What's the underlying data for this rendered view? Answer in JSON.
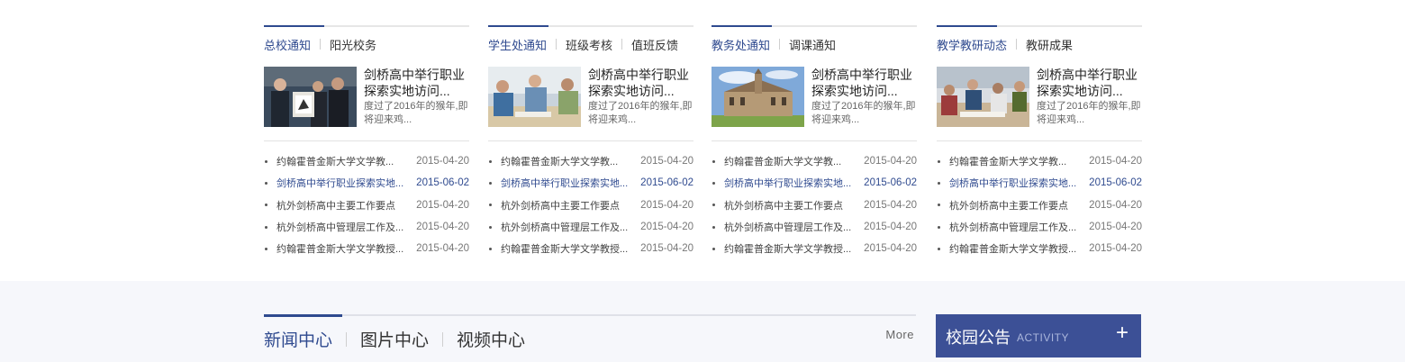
{
  "columns": [
    {
      "tabs": [
        "总校通知",
        "阳光校务"
      ],
      "feature": {
        "title": "剑桥高中举行职业探索实地访问...",
        "summary": "度过了2016年的猴年,即将迎来鸡..."
      },
      "items": [
        {
          "title": "约翰霍普金斯大学文学教...",
          "date": "2015-04-20"
        },
        {
          "title": "剑桥高中举行职业探索实地...",
          "date": "2015-06-02"
        },
        {
          "title": "杭外剑桥高中主要工作要点",
          "date": "2015-04-20"
        },
        {
          "title": "杭外剑桥高中管理层工作及...",
          "date": "2015-04-20"
        },
        {
          "title": "约翰霍普金斯大学文学教授...",
          "date": "2015-04-20"
        }
      ]
    },
    {
      "tabs": [
        "学生处通知",
        "班级考核",
        "值班反馈"
      ],
      "feature": {
        "title": "剑桥高中举行职业探索实地访问...",
        "summary": "度过了2016年的猴年,即将迎来鸡..."
      },
      "items": [
        {
          "title": "约翰霍普金斯大学文学教...",
          "date": "2015-04-20"
        },
        {
          "title": "剑桥高中举行职业探索实地...",
          "date": "2015-06-02"
        },
        {
          "title": "杭外剑桥高中主要工作要点",
          "date": "2015-04-20"
        },
        {
          "title": "杭外剑桥高中管理层工作及...",
          "date": "2015-04-20"
        },
        {
          "title": "约翰霍普金斯大学文学教授...",
          "date": "2015-04-20"
        }
      ]
    },
    {
      "tabs": [
        "教务处通知",
        "调课通知"
      ],
      "feature": {
        "title": "剑桥高中举行职业探索实地访问...",
        "summary": "度过了2016年的猴年,即将迎来鸡..."
      },
      "items": [
        {
          "title": "约翰霍普金斯大学文学教...",
          "date": "2015-04-20"
        },
        {
          "title": "剑桥高中举行职业探索实地...",
          "date": "2015-06-02"
        },
        {
          "title": "杭外剑桥高中主要工作要点",
          "date": "2015-04-20"
        },
        {
          "title": "杭外剑桥高中管理层工作及...",
          "date": "2015-04-20"
        },
        {
          "title": "约翰霍普金斯大学文学教授...",
          "date": "2015-04-20"
        }
      ]
    },
    {
      "tabs": [
        "教学教研动态",
        "教研成果"
      ],
      "feature": {
        "title": "剑桥高中举行职业探索实地访问...",
        "summary": "度过了2016年的猴年,即将迎来鸡..."
      },
      "items": [
        {
          "title": "约翰霍普金斯大学文学教...",
          "date": "2015-04-20"
        },
        {
          "title": "剑桥高中举行职业探索实地...",
          "date": "2015-06-02"
        },
        {
          "title": "杭外剑桥高中主要工作要点",
          "date": "2015-04-20"
        },
        {
          "title": "杭外剑桥高中管理层工作及...",
          "date": "2015-04-20"
        },
        {
          "title": "约翰霍普金斯大学文学教授...",
          "date": "2015-04-20"
        }
      ]
    }
  ],
  "news": {
    "tabs": [
      "新闻中心",
      "图片中心",
      "视频中心"
    ],
    "more": "More"
  },
  "notice": {
    "title": "校园公告",
    "subtitle": "ACTIVITY",
    "plus": "+"
  },
  "colors": {
    "accent": "#2f4a8f",
    "notice_bg": "#3c5096",
    "bottom_bg": "#f6f7fb"
  }
}
